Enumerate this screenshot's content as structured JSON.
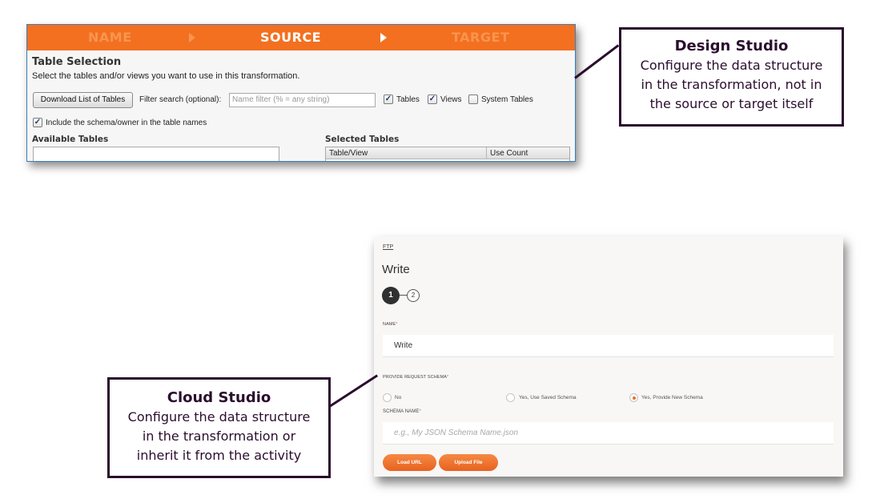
{
  "design_studio": {
    "wizard_steps": [
      {
        "label": "NAME",
        "state": "inactive"
      },
      {
        "label": "SOURCE",
        "state": "active"
      },
      {
        "label": "TARGET",
        "state": "inactive"
      }
    ],
    "section_title": "Table Selection",
    "instructions": "Select the tables and/or views you want to use in this transformation.",
    "download_button": "Download List of Tables",
    "filter_label": "Filter search (optional):",
    "filter_placeholder": "Name filter (% = any string)",
    "filter_value": "",
    "checkboxes": {
      "tables": {
        "label": "Tables",
        "checked": true
      },
      "views": {
        "label": "Views",
        "checked": true
      },
      "system_tables": {
        "label": "System Tables",
        "checked": false
      },
      "include_schema": {
        "label": "Include the schema/owner in the table names",
        "checked": true
      }
    },
    "available_tables_label": "Available Tables",
    "selected_tables_label": "Selected Tables",
    "selected_table_columns": [
      "Table/View",
      "Use Count"
    ],
    "accent_color": "#f37021"
  },
  "callouts": {
    "design": {
      "title": "Design Studio",
      "lines": [
        "Configure the data structure",
        "in the transformation, not in",
        "the source or target itself"
      ]
    },
    "cloud": {
      "title": "Cloud Studio",
      "lines": [
        "Configure the data structure",
        "in the transformation or",
        "inherit it from the activity"
      ]
    }
  },
  "cloud_studio": {
    "breadcrumb": "FTP",
    "title": "Write",
    "steps": [
      {
        "number": "1",
        "state": "active"
      },
      {
        "number": "2",
        "state": "inactive"
      }
    ],
    "name_label": "NAME",
    "name_value": "Write",
    "schema_question_label": "PROVIDE REQUEST SCHEMA",
    "schema_options": [
      {
        "label": "No",
        "selected": false
      },
      {
        "label": "Yes, Use Saved Schema",
        "selected": false
      },
      {
        "label": "Yes, Provide New Schema",
        "selected": true
      }
    ],
    "schema_name_label": "SCHEMA NAME",
    "schema_name_placeholder": "e.g., My JSON Schema Name.json",
    "schema_name_value": "",
    "required_marker": "*",
    "buttons": {
      "load_url": "Load URL",
      "upload_file": "Upload File"
    },
    "accent_color": "#e8702a"
  }
}
